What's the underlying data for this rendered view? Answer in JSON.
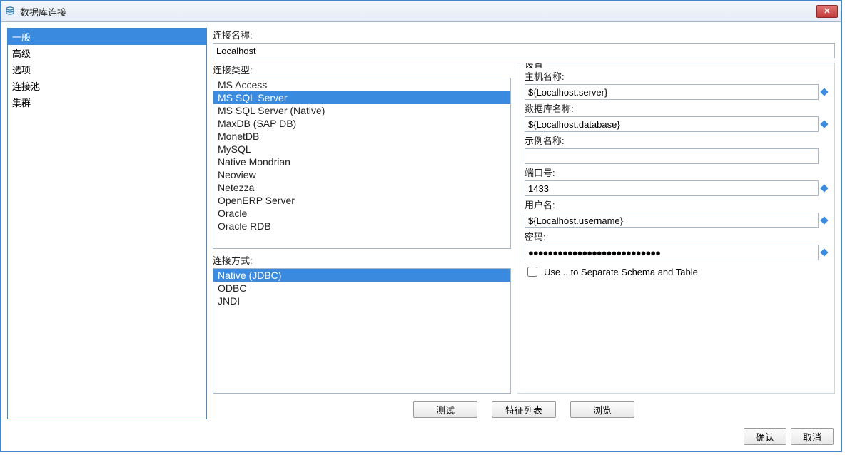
{
  "window": {
    "title": "数据库连接",
    "close_label": "✕"
  },
  "sidebar": {
    "items": [
      {
        "label": "一般",
        "selected": true
      },
      {
        "label": "高级",
        "selected": false
      },
      {
        "label": "选项",
        "selected": false
      },
      {
        "label": "连接池",
        "selected": false
      },
      {
        "label": "集群",
        "selected": false
      }
    ]
  },
  "main": {
    "conn_name_label": "连接名称:",
    "conn_name_value": "Localhost",
    "conn_type_label": "连接类型:",
    "conn_types": [
      {
        "label": "MS Access",
        "selected": false
      },
      {
        "label": "MS SQL Server",
        "selected": true
      },
      {
        "label": "MS SQL Server (Native)",
        "selected": false
      },
      {
        "label": "MaxDB (SAP DB)",
        "selected": false
      },
      {
        "label": "MonetDB",
        "selected": false
      },
      {
        "label": "MySQL",
        "selected": false
      },
      {
        "label": "Native Mondrian",
        "selected": false
      },
      {
        "label": "Neoview",
        "selected": false
      },
      {
        "label": "Netezza",
        "selected": false
      },
      {
        "label": "OpenERP Server",
        "selected": false
      },
      {
        "label": "Oracle",
        "selected": false
      },
      {
        "label": "Oracle RDB",
        "selected": false
      }
    ],
    "conn_access_label": "连接方式:",
    "conn_access": [
      {
        "label": "Native (JDBC)",
        "selected": true
      },
      {
        "label": "ODBC",
        "selected": false
      },
      {
        "label": "JNDI",
        "selected": false
      }
    ],
    "settings": {
      "legend": "设置",
      "host_label": "主机名称:",
      "host_value": "${Localhost.server}",
      "db_label": "数据库名称:",
      "db_value": "${Localhost.database}",
      "instance_label": "示例名称:",
      "instance_value": "",
      "port_label": "端口号:",
      "port_value": "1433",
      "user_label": "用户名:",
      "user_value": "${Localhost.username}",
      "pass_label": "密码:",
      "pass_value": "●●●●●●●●●●●●●●●●●●●●●●●●●●●",
      "separate_schema_label": "Use .. to Separate Schema and Table",
      "separate_schema_checked": false
    },
    "buttons": {
      "test": "测试",
      "feature_list": "特征列表",
      "browse": "浏览"
    }
  },
  "footer": {
    "ok": "确认",
    "cancel": "取消"
  }
}
